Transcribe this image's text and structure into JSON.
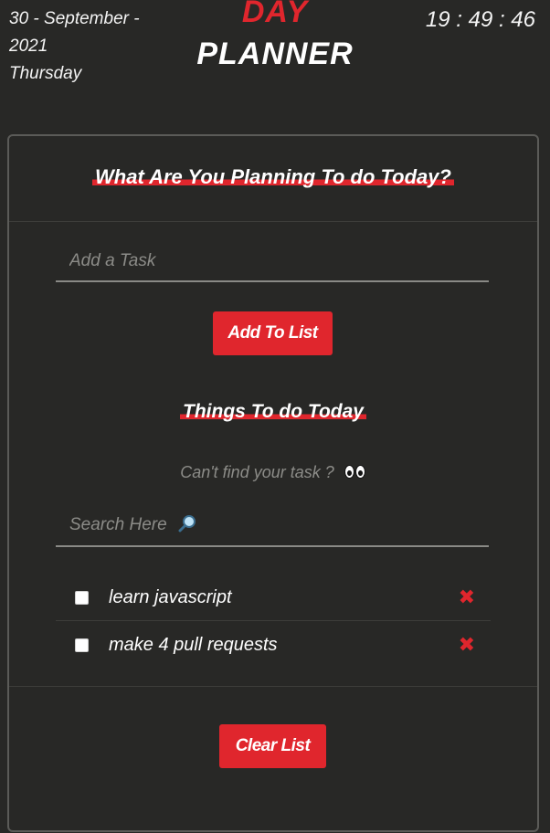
{
  "header": {
    "date_line1": "30 - September -",
    "date_line2": "2021",
    "weekday": "Thursday",
    "title_top": "DAY",
    "title_bottom": "PLANNER",
    "clock": "19 : 49 : 46"
  },
  "card": {
    "heading": "What Are You Planning To do Today?",
    "task_input_placeholder": "Add a Task",
    "task_input_value": "",
    "add_button_label": "Add To List",
    "list_heading": "Things To do Today",
    "search_hint": "Can't find your task ?",
    "search_placeholder": "Search Here",
    "search_value": "",
    "todos": [
      {
        "text": "learn javascript",
        "checked": false
      },
      {
        "text": "make 4 pull requests",
        "checked": false
      }
    ],
    "clear_button_label": "Clear List"
  },
  "colors": {
    "background": "#282826",
    "accent": "#e0262d",
    "text": "#ffffff",
    "muted": "#8c8c88"
  },
  "icons": {
    "search": "magnifier-icon",
    "hint": "eyes-icon",
    "remove": "close-x-icon"
  }
}
